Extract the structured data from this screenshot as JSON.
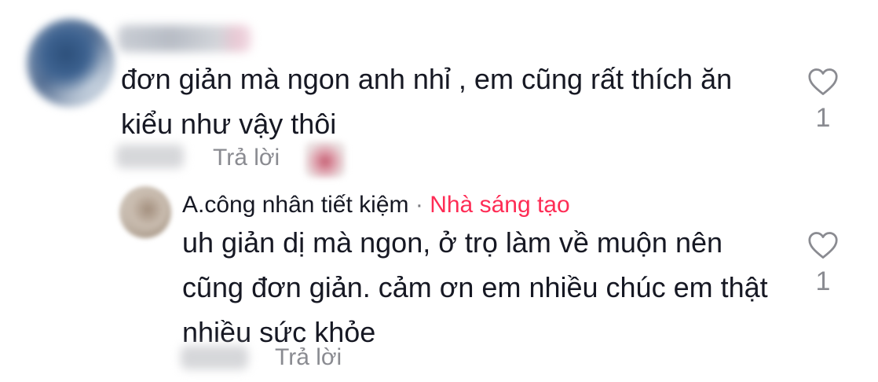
{
  "comment": {
    "text": "đơn giản mà ngon anh nhỉ , em cũng rất thích ăn\nkiểu như vậy thôi",
    "reply_label": "Trả lời",
    "like_count": "1"
  },
  "reply": {
    "author": "A.công nhân tiết kiệm",
    "separator": "·",
    "badge": "Nhà sáng tạo",
    "text": "uh giản dị mà ngon, ở trọ làm về muộn nên\ncũng đơn giản. cảm ơn em nhiều chúc em thật\nnhiều sức khỏe",
    "reply_label": "Trả lời",
    "like_count": "1"
  },
  "icons": {
    "like": "heart-outline-icon"
  },
  "colors": {
    "creator_badge": "#fe2c55",
    "secondary_text": "#8a8b91",
    "primary_text": "#161823"
  }
}
